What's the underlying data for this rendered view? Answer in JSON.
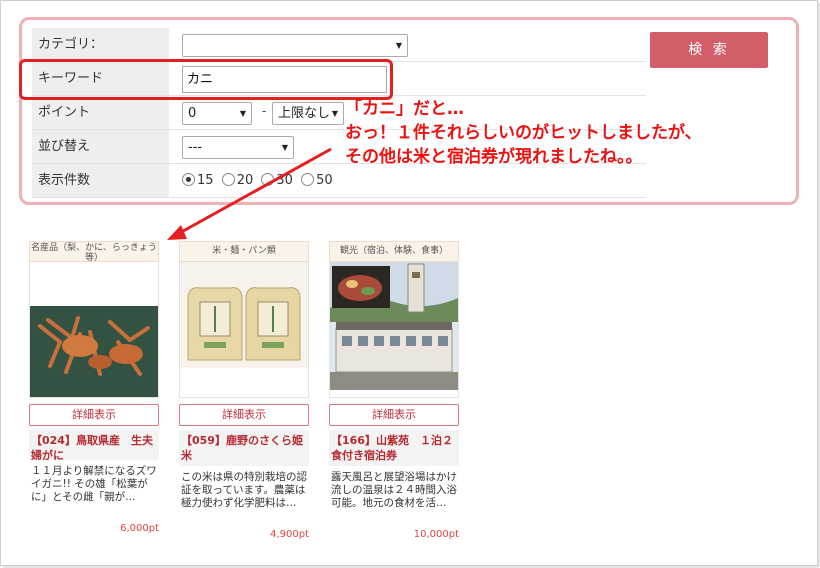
{
  "search": {
    "category_label": "カテゴリ：",
    "category_value": "",
    "keyword_label": "キーワード",
    "keyword_value": "カニ",
    "point_label": "ポイント",
    "point_min": "0",
    "point_max": "上限なし",
    "range_separator": "-",
    "sort_label": "並び替え",
    "sort_value": "---",
    "count_label": "表示件数",
    "count_options": [
      "15",
      "20",
      "30",
      "50"
    ],
    "count_selected": "15",
    "search_button": "検 索"
  },
  "annotation": {
    "line1": "「カニ」だと…",
    "line2": "おっ！１件それらしいのがヒットしましたが、",
    "line3": "その他は米と宿泊券が現れましたね。。"
  },
  "products": [
    {
      "category": "名産品（梨、かに、らっきょう等）",
      "detail_label": "詳細表示",
      "title": "【024】鳥取県産　生夫婦がに",
      "description": "１１月より解禁になるズワイガニ!! その雄「松葉がに」とその雌「親が…",
      "price": "6,000pt"
    },
    {
      "category": "米・麺・パン類",
      "detail_label": "詳細表示",
      "title": "【059】鹿野のさくら姫米",
      "description": "この米は県の特別栽培の認証を取っています。農薬は極力使わず化学肥料は…",
      "price": "4,900pt"
    },
    {
      "category": "観光（宿泊、体験、食事）",
      "detail_label": "詳細表示",
      "title": "【166】山紫苑　１泊２食付き宿泊券",
      "description": "露天風呂と展望浴場はかけ流しの温泉は２４時間入浴可能。地元の食材を活…",
      "price": "10,000pt"
    }
  ],
  "colors": {
    "accent": "#d45d6a",
    "annotation": "#ee1111",
    "panel_border": "#f0b0b6"
  }
}
